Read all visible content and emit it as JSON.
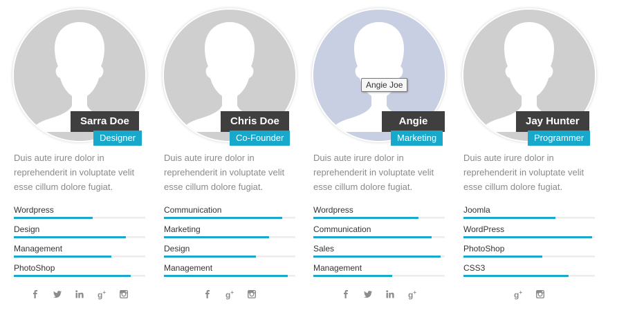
{
  "team": [
    {
      "name": "Sarra Doe",
      "role": "Designer",
      "description": "Duis aute irure dolor in reprehenderit in voluptate velit esse cillum dolore fugiat.",
      "skills": [
        {
          "label": "Wordpress",
          "level": 60
        },
        {
          "label": "Design",
          "level": 85
        },
        {
          "label": "Management",
          "level": 74
        },
        {
          "label": "PhotoShop",
          "level": 89
        }
      ],
      "social": [
        "facebook-icon",
        "twitter-icon",
        "linkedin-icon",
        "google-plus-icon",
        "instagram-icon"
      ]
    },
    {
      "name": "Chris Doe",
      "role": "Co-Founder",
      "description": "Duis aute irure dolor in reprehenderit in voluptate velit esse cillum dolore fugiat.",
      "skills": [
        {
          "label": "Communication",
          "level": 90
        },
        {
          "label": "Marketing",
          "level": 80
        },
        {
          "label": "Design",
          "level": 70
        },
        {
          "label": "Management",
          "level": 94
        }
      ],
      "social": [
        "facebook-icon",
        "google-plus-icon",
        "instagram-icon"
      ]
    },
    {
      "name": "Angie Joe",
      "role": "Marketing",
      "tooltip": "Angie Joe",
      "description": "Duis aute irure dolor in reprehenderit in voluptate velit esse cillum dolore fugiat.",
      "skills": [
        {
          "label": "Wordpress",
          "level": 80
        },
        {
          "label": "Communication",
          "level": 90
        },
        {
          "label": "Sales",
          "level": 97
        },
        {
          "label": "Management",
          "level": 60
        }
      ],
      "social": [
        "facebook-icon",
        "twitter-icon",
        "linkedin-icon",
        "google-plus-icon"
      ]
    },
    {
      "name": "Jay Hunter",
      "role": "Programmer",
      "description": "Duis aute irure dolor in reprehenderit in voluptate velit esse cillum dolore fugiat.",
      "skills": [
        {
          "label": "Joomla",
          "level": 70
        },
        {
          "label": "WordPress",
          "level": 98
        },
        {
          "label": "PhotoShop",
          "level": 60
        },
        {
          "label": "CSS3",
          "level": 80
        }
      ],
      "social": [
        "google-plus-icon",
        "instagram-icon"
      ]
    }
  ],
  "colors": {
    "accent": "#17a8cc",
    "name_tag_bg": "#3f3f3f",
    "avatar_bg": "#cfcfcf",
    "avatar_hover_bg": "#c8cfe2",
    "description_text": "#8a8a8a"
  }
}
